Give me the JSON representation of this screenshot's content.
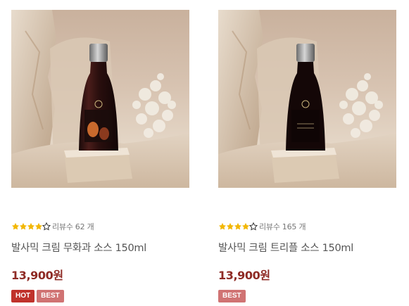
{
  "products": [
    {
      "review_label": "리뷰수",
      "review_count": "62 개",
      "rating": 4.5,
      "name": "발사믹 크림 무화과 소스 150ml",
      "price": "13,900원",
      "badges": {
        "hot": "HOT",
        "best": "BEST"
      }
    },
    {
      "review_label": "리뷰수",
      "review_count": "165 개",
      "rating": 4.5,
      "name": "발사믹 크림 트리플 소스 150ml",
      "price": "13,900원",
      "badges": {
        "best": "BEST"
      }
    }
  ],
  "colors": {
    "star": "#f2b705",
    "price": "#8e2a24",
    "badge_hot": "#c0322b",
    "badge_best": "#d07373"
  }
}
